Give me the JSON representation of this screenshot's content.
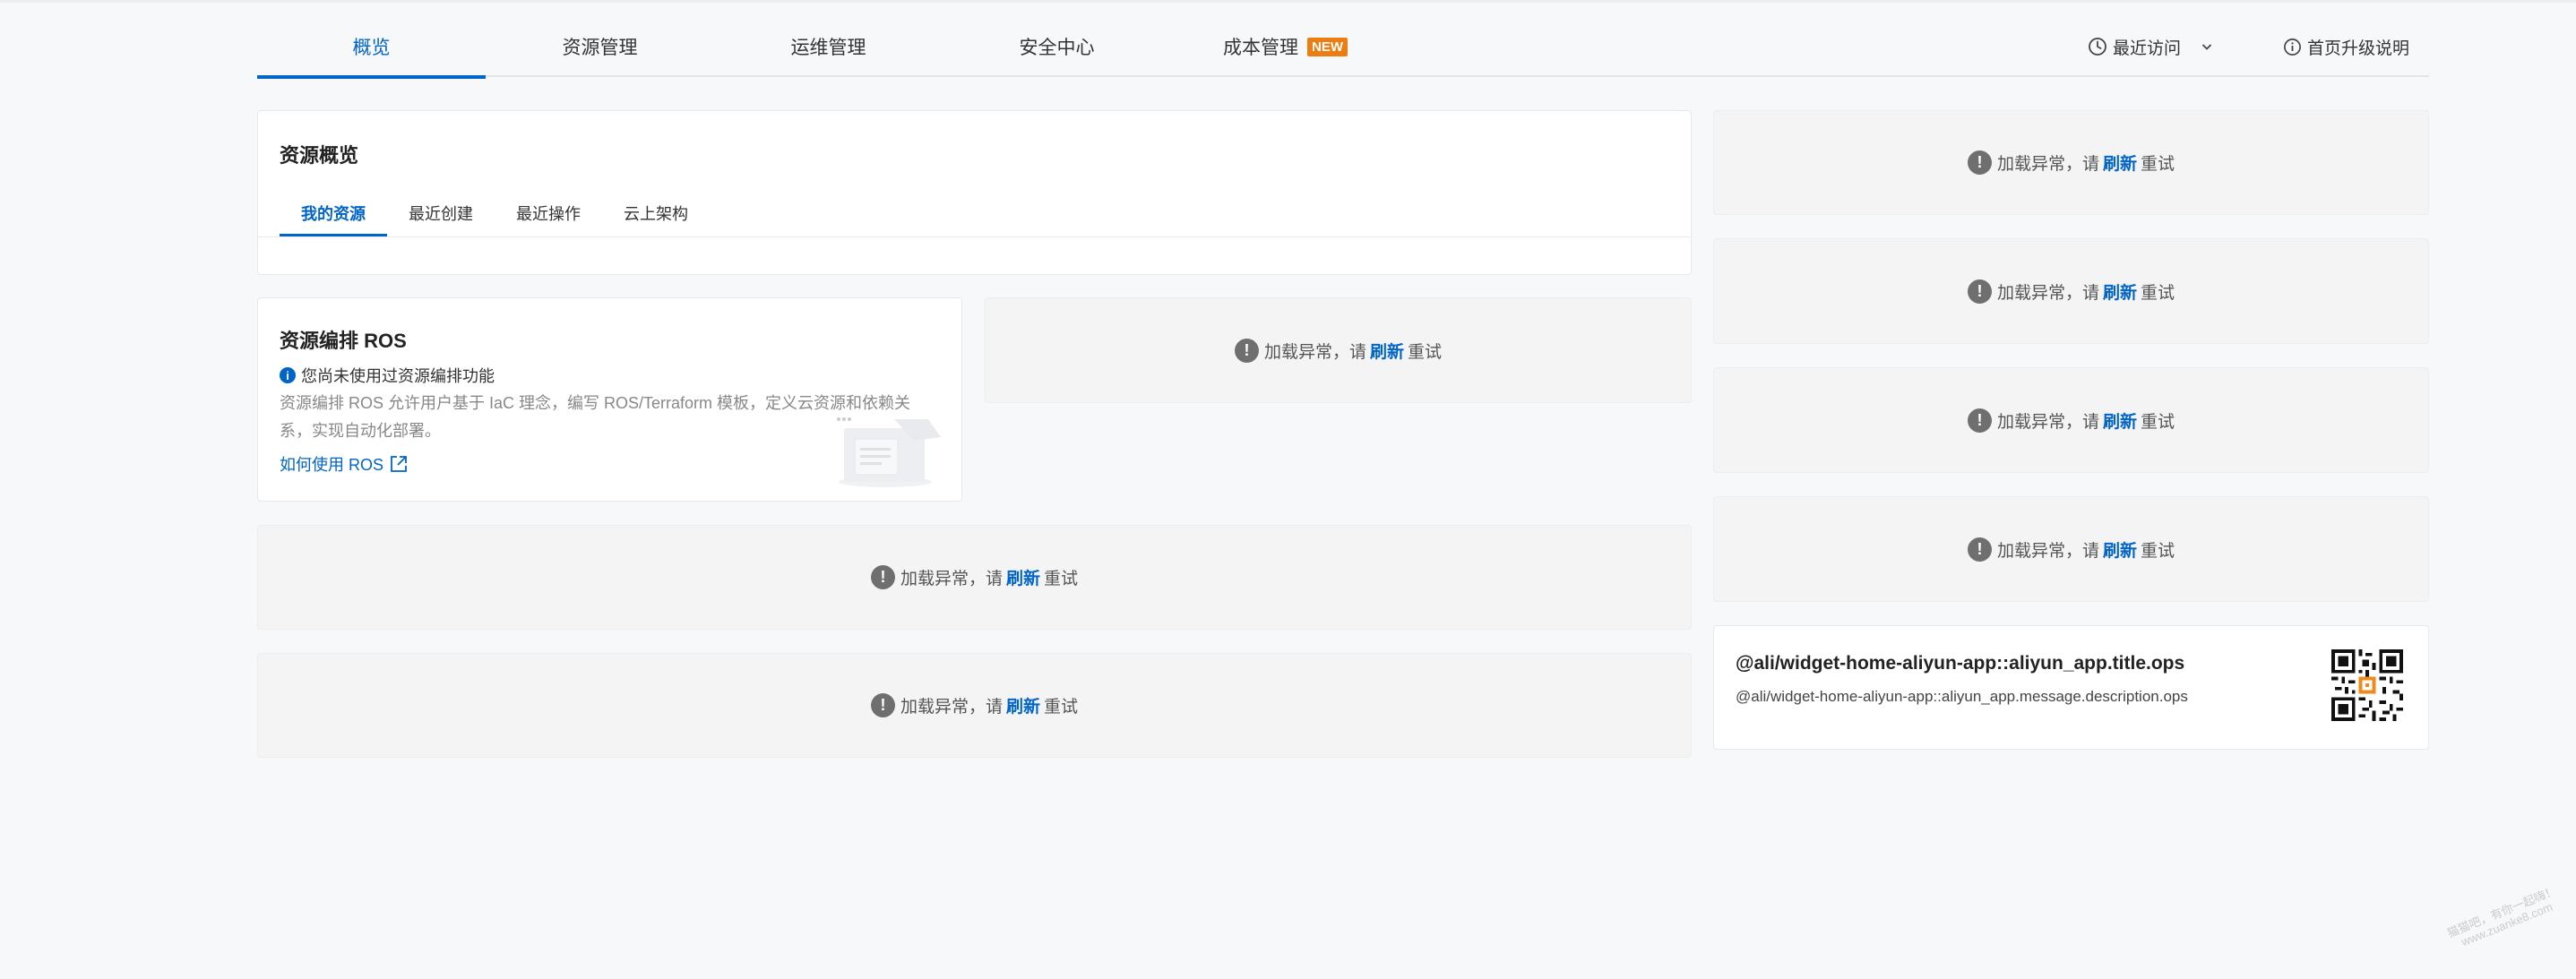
{
  "nav": {
    "tabs": [
      {
        "label": "概览",
        "active": true
      },
      {
        "label": "资源管理"
      },
      {
        "label": "运维管理"
      },
      {
        "label": "安全中心"
      },
      {
        "label": "成本管理",
        "badge": "NEW"
      }
    ],
    "recent_label": "最近访问",
    "upgrade_label": "首页升级说明"
  },
  "resource_overview": {
    "title": "资源概览",
    "tabs": [
      "我的资源",
      "最近创建",
      "最近操作",
      "云上架构"
    ]
  },
  "ros": {
    "title": "资源编排 ROS",
    "info": "您尚未使用过资源编排功能",
    "description": "资源编排 ROS 允许用户基于 IaC 理念，编写 ROS/Terraform 模板，定义云资源和依赖关系，实现自动化部署。",
    "link": "如何使用 ROS"
  },
  "load_error": {
    "prefix": "加载异常，请",
    "action": "刷新",
    "suffix": "重试"
  },
  "aliyun_app": {
    "title": "@ali/widget-home-aliyun-app::aliyun_app.title.ops",
    "description": "@ali/widget-home-aliyun-app::aliyun_app.message.description.ops"
  },
  "watermark": {
    "line1": "猫猫吧，有你一起嗨！",
    "line2": "www.zuanke8.com"
  },
  "colors": {
    "accent": "#0064c8",
    "badge": "#ed7d11",
    "error_icon": "#6f6f6f",
    "page_bg": "#f7f8fa"
  }
}
